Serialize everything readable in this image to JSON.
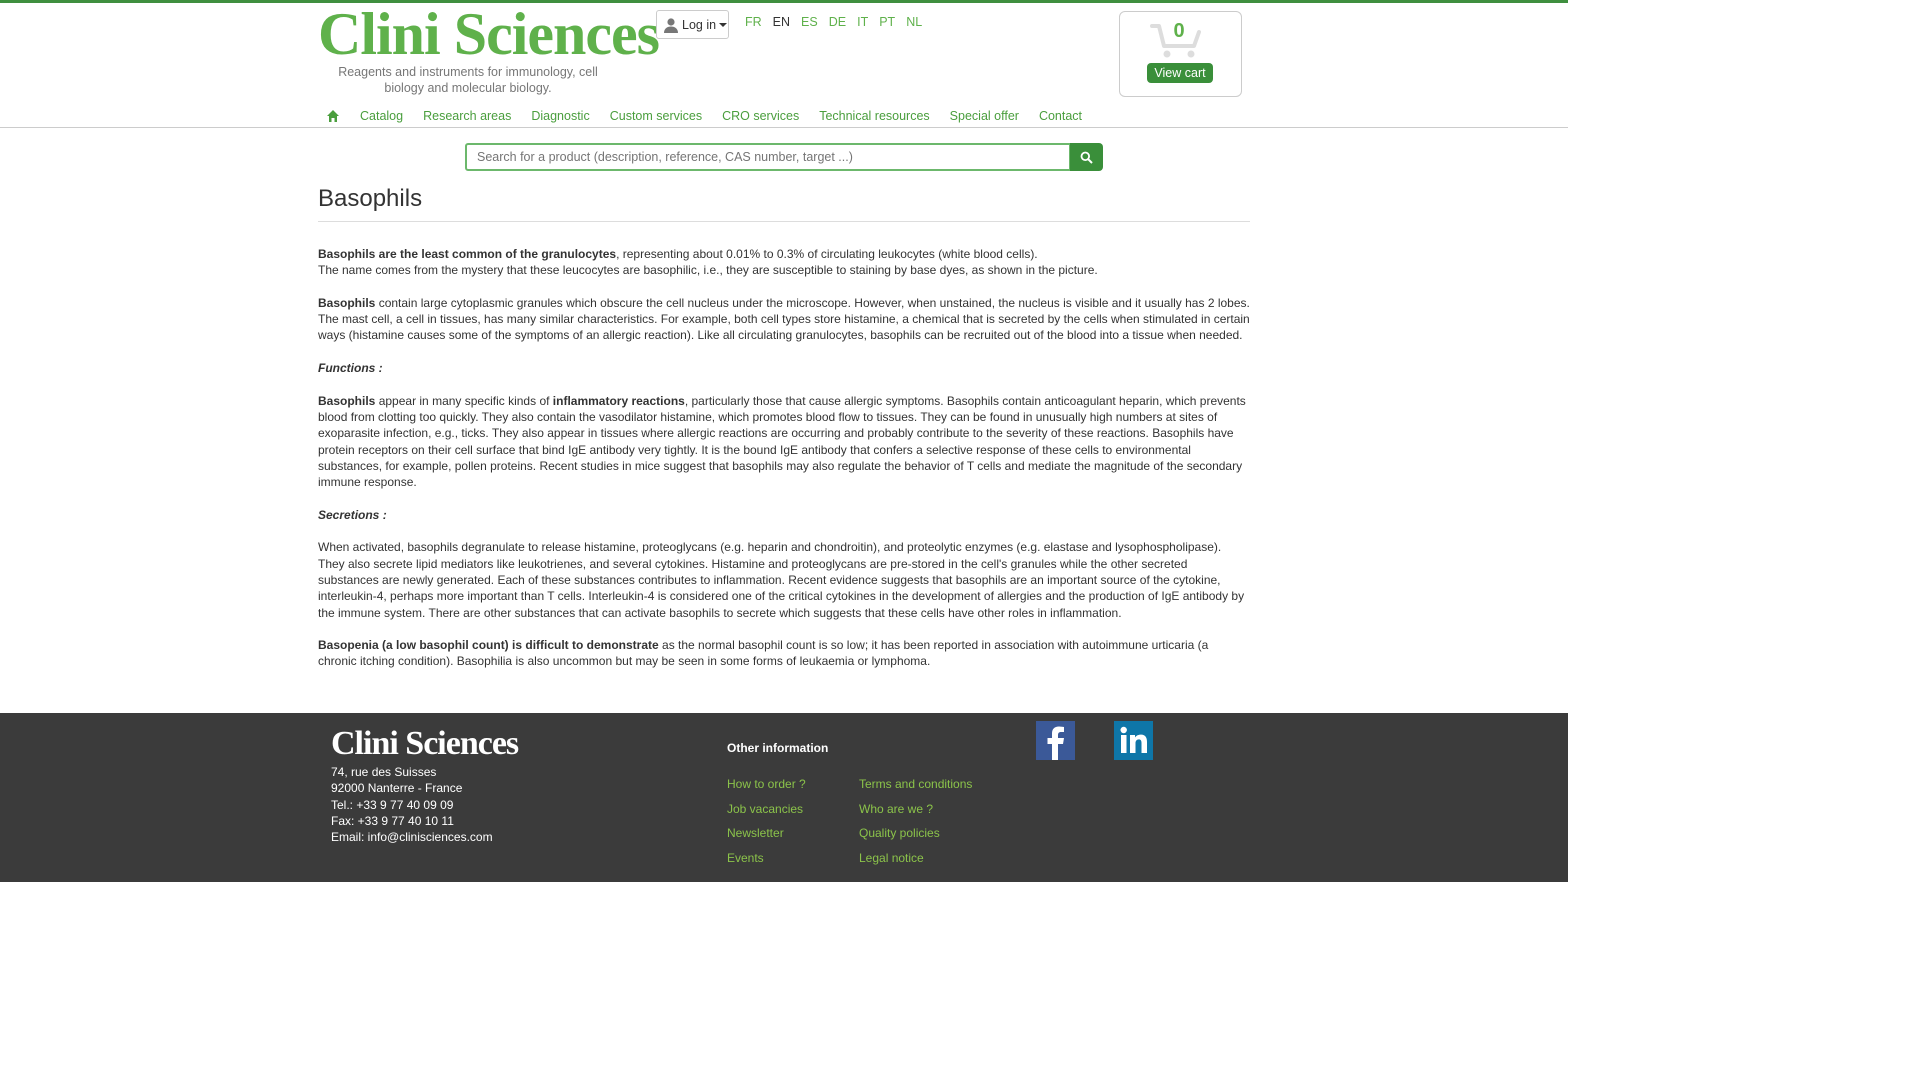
{
  "brand": {
    "logo_text": "Clini Sciences",
    "tagline": "Reagents and instruments for immunology, cell biology and molecular biology."
  },
  "header": {
    "login_label": "Log in",
    "languages": [
      "FR",
      "EN",
      "ES",
      "DE",
      "IT",
      "PT",
      "NL"
    ],
    "active_language": "EN",
    "cart": {
      "count": "0",
      "view_label": "View cart"
    }
  },
  "nav": {
    "items": [
      "Catalog",
      "Research areas",
      "Diagnostic",
      "Custom services",
      "CRO services",
      "Technical resources",
      "Special offer",
      "Contact"
    ]
  },
  "search": {
    "placeholder": "Search for a product (description, reference, CAS number, target ...)"
  },
  "page": {
    "title": "Basophils",
    "p1_bold": "Basophils are the least common of the granulocytes",
    "p1_rest": ", representing about 0.01% to 0.3% of circulating leukocytes (white blood cells).",
    "p1_line2": "The name comes from the mystery that these leucocytes are basophilic, i.e., they are susceptible to staining by base dyes, as shown in the picture.",
    "p2_bold": "Basophils",
    "p2_rest": " contain large cytoplasmic granules which obscure the cell nucleus under the microscope. However, when unstained, the nucleus is visible and it usually has 2 lobes. The mast cell, a cell in tissues, has many similar characteristics. For example, both cell types store histamine, a chemical that is secreted by the cells when stimulated in certain ways (histamine causes some of the symptoms of an allergic reaction). Like all circulating granulocytes, basophils can be recruited out of the blood into a tissue when needed.",
    "functions_heading": "Functions :",
    "p3_bold1": "Basophils",
    "p3_mid": " appear in many specific kinds of ",
    "p3_bold2": "inflammatory reactions",
    "p3_rest": ", particularly those that cause allergic symptoms. Basophils contain anticoagulant heparin, which prevents blood from clotting too quickly. They also contain the vasodilator histamine, which promotes blood flow to tissues. They can be found in unusually high numbers at sites of exoparasite infection, e.g., ticks. They also appear in tissues where allergic reactions are occurring and probably contribute to the severity of these reactions. Basophils have protein receptors on their cell surface that bind IgE antibody very tightly. It is the bound IgE antibody that confers a selective response of these cells to environmental substances, for example, pollen proteins. Recent studies in mice suggest that basophils may also regulate the behavior of T cells and mediate the magnitude of the secondary immune response.",
    "secretions_heading": "Secretions :",
    "p4": "When activated, basophils degranulate to release histamine, proteoglycans (e.g. heparin and chondroitin), and proteolytic enzymes (e.g. elastase and lysophospholipase). They also secrete lipid mediators like leukotrienes, and several cytokines. Histamine and proteoglycans are pre-stored in the cell's granules while the other secreted substances are newly generated. Each of these substances contributes to inflammation. Recent evidence suggests that basophils are an important source of the cytokine, interleukin-4, perhaps more important than T cells. Interleukin-4 is considered one of the critical cytokines in the development of allergies and the production of IgE antibody by the immune system. There are other substances that can activate basophils to secrete which suggests that these cells have other roles in inflammation.",
    "p5_bold": "Basopenia (a low basophil count) is difficult to demonstrate",
    "p5_rest": " as the normal basophil count is so low; it has been reported in association with autoimmune urticaria (a chronic itching condition). Basophilia is also uncommon but may be seen in some forms of leukaemia or lymphoma."
  },
  "footer": {
    "logo_text": "Clini Sciences",
    "address_lines": [
      "74, rue des Suisses",
      "92000 Nanterre - France",
      "Tel.: +33 9 77 40 09 09",
      "Fax: +33 9 77 40 10 11",
      "Email: info@clinisciences.com"
    ],
    "other_heading": "Other information",
    "col1": [
      "How to order ?",
      "Job vacancies",
      "Newsletter",
      "Events"
    ],
    "col2": [
      "Terms and conditions",
      "Who are we ?",
      "Quality policies",
      "Legal notice"
    ]
  }
}
